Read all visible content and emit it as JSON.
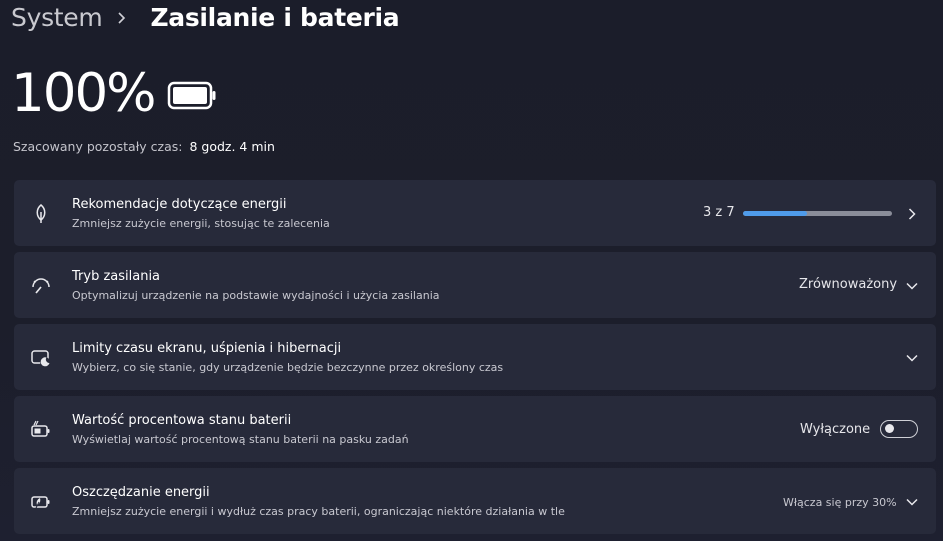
{
  "breadcrumb": {
    "parent": "System",
    "current": "Zasilanie i bateria"
  },
  "battery": {
    "percent_text": "100%",
    "level": 1.0,
    "estimate_label": "Szacowany pozostały czas:",
    "estimate_value": "8 godz. 4 min"
  },
  "cards": {
    "recommendations": {
      "icon": "leaf-icon",
      "title": "Rekomendacje dotyczące energii",
      "description": "Zmniejsz zużycie energii, stosując te zalecenia",
      "progress_text": "3 z 7",
      "progress_fraction": 0.43
    },
    "power_mode": {
      "icon": "power-mode-gauge-icon",
      "title": "Tryb zasilania",
      "description": "Optymalizuj urządzenie na podstawie wydajności i użycia zasilania",
      "value": "Zrównoważony"
    },
    "screen_sleep": {
      "icon": "screen-sleep-icon",
      "title": "Limity czasu ekranu, uśpienia i hibernacji",
      "description": "Wybierz, co się stanie, gdy urządzenie będzie bezczynne przez określony czas"
    },
    "battery_percentage": {
      "icon": "battery-percentage-icon",
      "title": "Wartość procentowa stanu baterii",
      "description": "Wyświetlaj wartość procentową stanu baterii na pasku zadań",
      "toggle_label": "Wyłączone",
      "toggle_on": false
    },
    "energy_saver": {
      "icon": "energy-saver-icon",
      "title": "Oszczędzanie energii",
      "description": "Zmniejsz zużycie energii i wydłuż czas pracy baterii, ograniczając niektóre działania w tle",
      "value": "Włącza się przy 30%"
    }
  },
  "colors": {
    "accent": "#4f9bea",
    "card_bg": "#272a3a",
    "page_bg": "#1c1e2b"
  }
}
